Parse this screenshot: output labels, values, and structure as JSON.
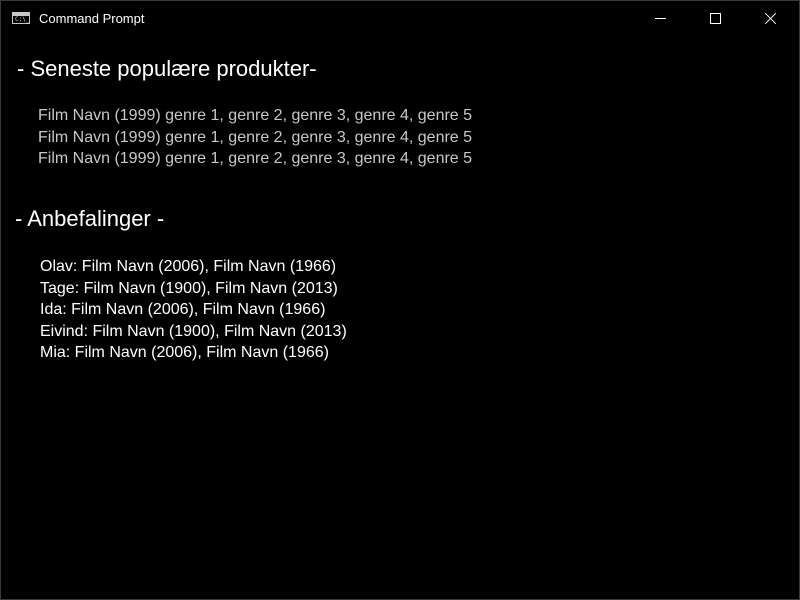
{
  "window": {
    "title": "Command Prompt",
    "controls": {
      "minimize_icon": "minimize-icon",
      "maximize_icon": "maximize-icon",
      "close_icon": "close-icon"
    }
  },
  "console": {
    "popular_heading": "- Seneste populære produkter-",
    "popular_items": [
      "Film Navn (1999) genre 1, genre 2, genre 3, genre 4, genre 5",
      "Film Navn (1999) genre 1, genre 2, genre 3, genre 4, genre 5",
      "Film Navn (1999) genre 1, genre 2, genre 3, genre 4, genre 5"
    ],
    "recommendations_heading": "- Anbefalinger -",
    "recommendations": [
      "Olav: Film Navn (2006), Film Navn (1966)",
      "Tage: Film Navn (1900), Film Navn (2013)",
      "Ida: Film Navn (2006), Film Navn (1966)",
      "Eivind: Film Navn (1900), Film Navn (2013)",
      "Mia: Film Navn (2006), Film Navn (1966)"
    ]
  },
  "colors": {
    "background": "#000000",
    "popular_text": "#c8c8c8",
    "recommendation_text": "#ffffff"
  }
}
